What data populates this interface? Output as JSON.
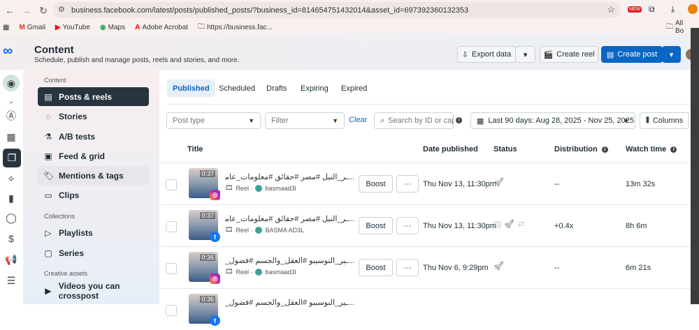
{
  "browser": {
    "url": "business.facebook.com/latest/posts/published_posts/?business_id=814654751432014&asset_id=697392360132353",
    "bookmarks": [
      "Gmail",
      "YouTube",
      "Maps",
      "Adobe Acrobat",
      "https://business.fac...",
      "All Bo"
    ],
    "ext_badge": "NEW"
  },
  "header": {
    "title": "Content",
    "subtitle": "Schedule, publish and manage posts, reels and stories, and more.",
    "export_label": "Export data",
    "create_reel_label": "Create reel",
    "create_post_label": "Create post"
  },
  "sidebar": {
    "sections": [
      "Content",
      "Collections",
      "Creative assets"
    ],
    "items": [
      {
        "label": "Posts & reels"
      },
      {
        "label": "Stories"
      },
      {
        "label": "A/B tests"
      },
      {
        "label": "Feed & grid"
      },
      {
        "label": "Mentions & tags"
      },
      {
        "label": "Clips"
      },
      {
        "label": "Playlists"
      },
      {
        "label": "Series"
      },
      {
        "label": "Videos you can crosspost"
      }
    ]
  },
  "tabs": [
    "Published",
    "Scheduled",
    "Drafts",
    "Expiring",
    "Expired"
  ],
  "filters": {
    "post_type_placeholder": "Post type",
    "filter_placeholder": "Filter",
    "clear_label": "Clear",
    "search_placeholder": "Search by ID or caption",
    "date_range": "Last 90 days: Aug 28, 2025 - Nov 25, 2025",
    "columns_label": "Columns"
  },
  "table": {
    "headers": [
      "Title",
      "Date published",
      "Status",
      "Distribution",
      "Watch time"
    ],
    "rows": [
      {
        "duration": "0:37",
        "platform": "instagram",
        "title": "...ـر_النيل #مصر #حقائق #معلومات_عامة ✨🌍",
        "type": "Reel ·",
        "account": "basmaad3l",
        "boost": "Boost",
        "date": "Thu Nov 13, 11:30pm",
        "distribution": "--",
        "watch_time": "13m 32s"
      },
      {
        "duration": "0:37",
        "platform": "facebook",
        "title": "...ـر_النيل #مصر #حقائق #معلومات_عامة ✨🌍",
        "type": "Reel ·",
        "account": "BASMA AD3L",
        "boost": "Boost",
        "date": "Thu Nov 13, 11:30pm",
        "distribution": "+0.4x",
        "watch_time": "8h 6m"
      },
      {
        "duration": "0:36",
        "platform": "instagram",
        "title": "...ـير_النوسيبو #العقل_والجسم #فضول_بلا_نهاية",
        "type": "Reel ·",
        "account": "basmaad3l",
        "boost": "Boost",
        "date": "Thu Nov 6, 9:29pm",
        "distribution": "--",
        "watch_time": "6m 21s"
      },
      {
        "duration": "0:36",
        "platform": "facebook",
        "title": "...ـير_النوسيبو #العقل_والجسم #فضول_بلا_نهاية",
        "type": "",
        "account": "",
        "boost": "",
        "date": "",
        "distribution": "",
        "watch_time": ""
      }
    ]
  },
  "colors": {
    "primary": "#0a66c2",
    "sidebar_active": "#283540"
  }
}
